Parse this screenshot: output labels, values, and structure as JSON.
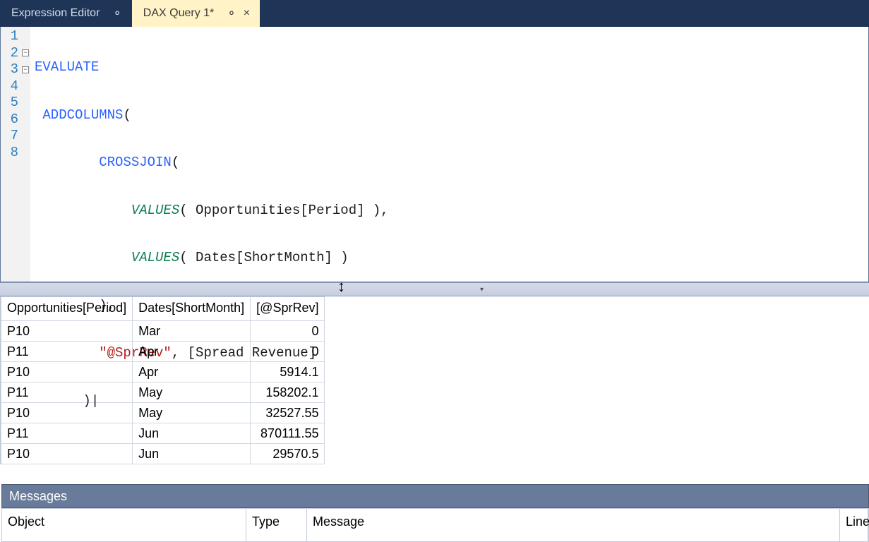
{
  "tabs": [
    {
      "label": "Expression Editor",
      "active": false,
      "pin": "⚬",
      "close": ""
    },
    {
      "label": "DAX Query 1*",
      "active": true,
      "pin": "⚬",
      "close": "×"
    }
  ],
  "lineNumbers": [
    "1",
    "2",
    "3",
    "4",
    "5",
    "6",
    "7",
    "8"
  ],
  "code": {
    "l1": {
      "a": "EVALUATE"
    },
    "l2": {
      "a": " ",
      "b": "ADDCOLUMNS",
      "c": "("
    },
    "l3": {
      "a": "        ",
      "b": "CROSSJOIN",
      "c": "("
    },
    "l4": {
      "a": "            ",
      "b": "VALUES",
      "c": "( Opportunities[Period] ),"
    },
    "l5": {
      "a": "            ",
      "b": "VALUES",
      "c": "( Dates[ShortMonth] )"
    },
    "l6": {
      "a": "        ",
      "c": "),"
    },
    "l7": {
      "a": "        ",
      "d": "\"@SprRev\"",
      "c": ", [Spread Revenue]"
    },
    "l8": {
      "a": "      ",
      "c": ")|"
    }
  },
  "results": {
    "columns": [
      "Opportunities[Period]",
      "Dates[ShortMonth]",
      "[@SprRev]"
    ],
    "rows": [
      {
        "period": "P10",
        "month": "Mar",
        "rev": "0"
      },
      {
        "period": "P11",
        "month": "Apr",
        "rev": "0"
      },
      {
        "period": "P10",
        "month": "Apr",
        "rev": "5914.1"
      },
      {
        "period": "P11",
        "month": "May",
        "rev": "158202.1"
      },
      {
        "period": "P10",
        "month": "May",
        "rev": "32527.55"
      },
      {
        "period": "P11",
        "month": "Jun",
        "rev": "870111.55"
      },
      {
        "period": "P10",
        "month": "Jun",
        "rev": "29570.5"
      }
    ]
  },
  "messages": {
    "title": "Messages",
    "cols": {
      "object": "Object",
      "type": "Type",
      "message": "Message",
      "line": "Line"
    }
  }
}
